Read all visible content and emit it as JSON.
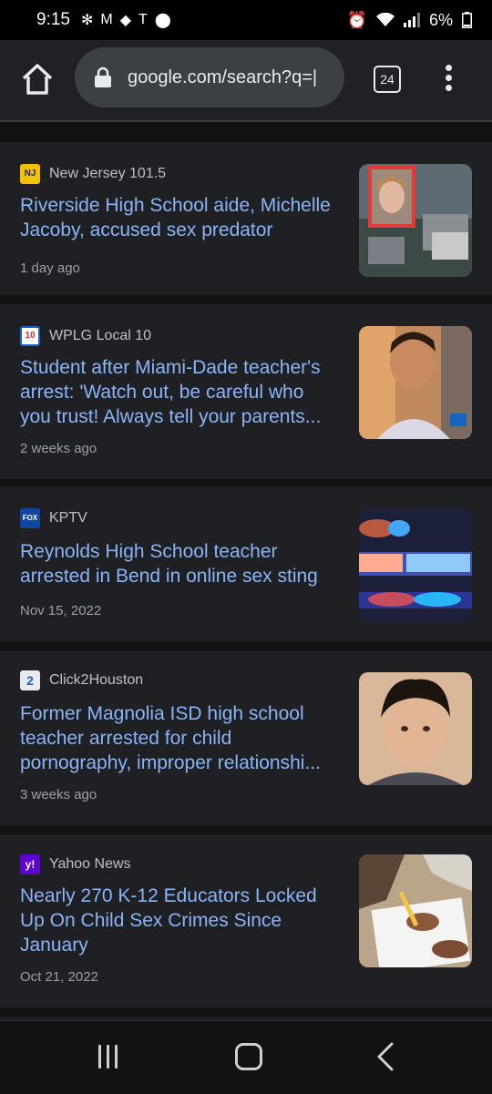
{
  "status_bar": {
    "time": "9:15",
    "battery": "6%"
  },
  "browser": {
    "url": "google.com/search?q=|",
    "tab_count": "24"
  },
  "articles": [
    {
      "source": "New Jersey 101.5",
      "icon_text": "NJ",
      "headline": "Riverside High School aide, Michelle Jacoby, accused sex predator",
      "time": "1 day ago"
    },
    {
      "source": "WPLG Local 10",
      "icon_text": "10",
      "headline": "Student after Miami-Dade teacher's arrest: 'Watch out, be careful who you trust! Always tell your parents...",
      "time": "2 weeks ago"
    },
    {
      "source": "KPTV",
      "icon_text": "FOX",
      "headline": "Reynolds High School teacher arrested in Bend in online sex sting",
      "time": "Nov 15, 2022"
    },
    {
      "source": "Click2Houston",
      "icon_text": "2",
      "headline": "Former Magnolia ISD high school teacher arrested for child pornography, improper relationshi...",
      "time": "3 weeks ago"
    },
    {
      "source": "Yahoo News",
      "icon_text": "y!",
      "headline": "Nearly 270 K-12 Educators Locked Up On Child Sex Crimes Since January",
      "time": "Oct 21, 2022"
    }
  ],
  "colors": {
    "link": "#8ab4f8",
    "card_bg": "#1f2023",
    "page_bg": "#121212"
  }
}
